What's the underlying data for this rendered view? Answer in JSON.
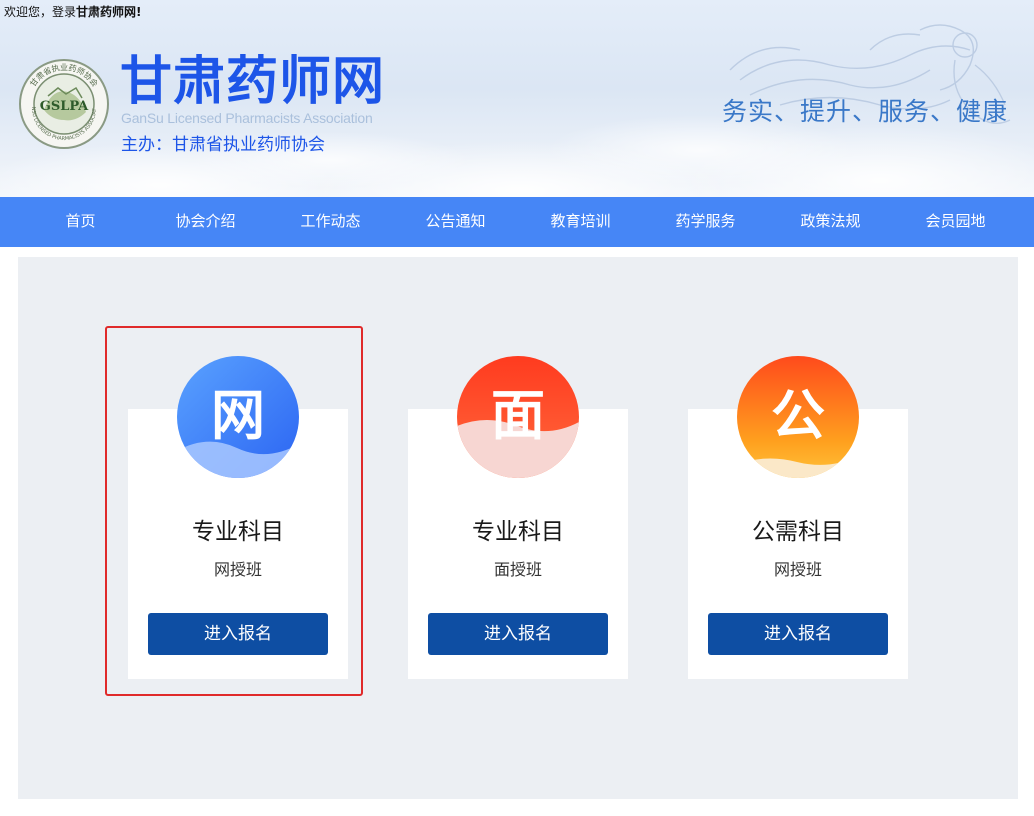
{
  "header": {
    "welcome_prefix": "欢迎您，登录",
    "welcome_site": "甘肃药师网!",
    "site_title": "甘肃药师网",
    "site_subtitle_en": "GanSu Licensed Pharmacists Association",
    "sponsor": "主办：甘肃省执业药师协会",
    "slogan": "务实、提升、服务、健康",
    "logo": {
      "text": "GSLPA",
      "ring_top": "甘肃省执业药师协会",
      "ring_bottom": "GANSU LICENSED PHARMACISTS ASSOCIATION"
    }
  },
  "nav": {
    "items": [
      {
        "label": "首页"
      },
      {
        "label": "协会介绍"
      },
      {
        "label": "工作动态"
      },
      {
        "label": "公告通知"
      },
      {
        "label": "教育培训"
      },
      {
        "label": "药学服务"
      },
      {
        "label": "政策法规"
      },
      {
        "label": "会员园地"
      }
    ]
  },
  "cards": [
    {
      "icon_char": "网",
      "title": "专业科目",
      "subtitle": "网授班",
      "button": "进入报名",
      "selected": true
    },
    {
      "icon_char": "面",
      "title": "专业科目",
      "subtitle": "面授班",
      "button": "进入报名",
      "selected": false
    },
    {
      "icon_char": "公",
      "title": "公需科目",
      "subtitle": "网授班",
      "button": "进入报名",
      "selected": false
    }
  ],
  "colors": {
    "brand_blue": "#1d55e8",
    "nav_bg": "#4686f6",
    "button_bg": "#0e4ea3",
    "highlight_border": "#e02a2a"
  }
}
